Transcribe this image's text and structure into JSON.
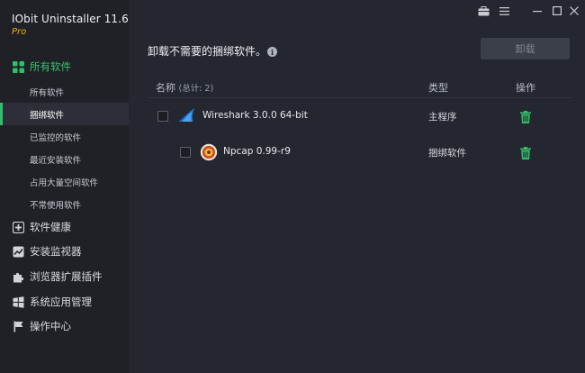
{
  "app": {
    "title": "IObit Uninstaller 11.6",
    "edition": "Pro"
  },
  "sidebar": {
    "sections": [
      {
        "label": "所有软件",
        "icon": "grid-icon",
        "active": true,
        "items": [
          {
            "label": "所有软件"
          },
          {
            "label": "捆绑软件",
            "selected": true
          },
          {
            "label": "已监控的软件"
          },
          {
            "label": "最近安装软件"
          },
          {
            "label": "占用大量空间软件"
          },
          {
            "label": "不常使用软件"
          }
        ]
      },
      {
        "label": "软件健康",
        "icon": "health-icon"
      },
      {
        "label": "安装监视器",
        "icon": "chart-icon"
      },
      {
        "label": "浏览器扩展插件",
        "icon": "puzzle-icon"
      },
      {
        "label": "系统应用管理",
        "icon": "windows-icon"
      },
      {
        "label": "操作中心",
        "icon": "flag-icon"
      }
    ]
  },
  "main": {
    "headline": "卸载不需要的捆绑软件。",
    "uninstall_label": "卸载",
    "table": {
      "col_name": "名称",
      "col_name_count": "(总计: 2)",
      "col_type": "类型",
      "col_action": "操作",
      "rows": [
        {
          "name": "Wireshark 3.0.0 64-bit",
          "type": "主程序",
          "icon": "wireshark-icon",
          "checked": false
        },
        {
          "name": "Npcap 0.99-r9",
          "type": "捆绑软件",
          "icon": "npcap-icon",
          "checked": false
        }
      ]
    }
  },
  "colors": {
    "accent": "#30c06a",
    "edition": "#e6b417",
    "background": "#24272f",
    "sidebar": "#1f2126"
  }
}
